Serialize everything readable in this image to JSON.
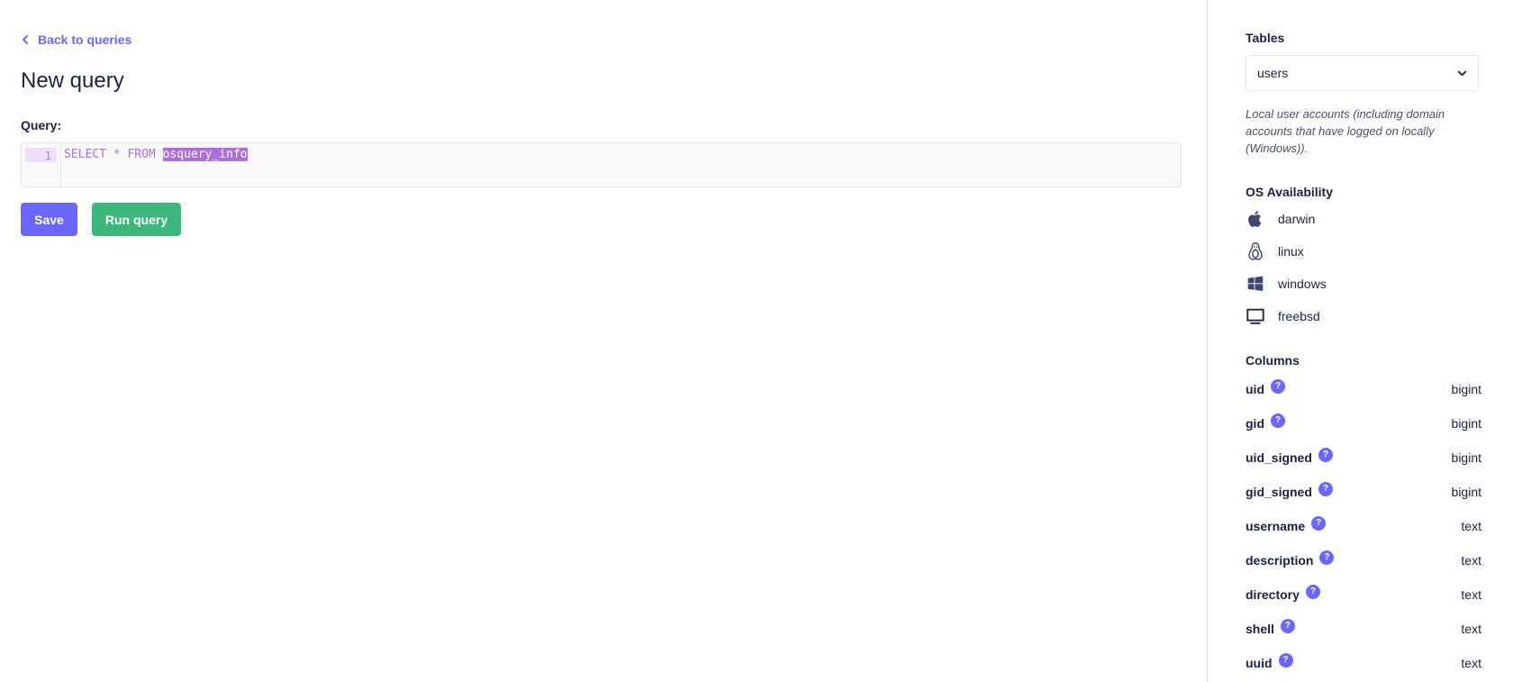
{
  "nav": {
    "back_label": "Back to queries"
  },
  "page": {
    "title": "New query",
    "query_label": "Query:"
  },
  "editor": {
    "line_number": "1",
    "keyword_select": "SELECT",
    "star": "*",
    "keyword_from": "FROM",
    "table_token": "osquery_info"
  },
  "actions": {
    "save_label": "Save",
    "run_label": "Run query"
  },
  "sidebar": {
    "tables_heading": "Tables",
    "selected_table": "users",
    "description": "Local user accounts (including domain accounts that have logged on locally (Windows)).",
    "os_heading": "OS Availability",
    "os": [
      {
        "label": "darwin",
        "icon": "apple-icon"
      },
      {
        "label": "linux",
        "icon": "linux-penguin-icon"
      },
      {
        "label": "windows",
        "icon": "windows-icon"
      },
      {
        "label": "freebsd",
        "icon": "monitor-icon"
      }
    ],
    "columns_heading": "Columns",
    "columns": [
      {
        "name": "uid",
        "type": "bigint"
      },
      {
        "name": "gid",
        "type": "bigint"
      },
      {
        "name": "uid_signed",
        "type": "bigint"
      },
      {
        "name": "gid_signed",
        "type": "bigint"
      },
      {
        "name": "username",
        "type": "text"
      },
      {
        "name": "description",
        "type": "text"
      },
      {
        "name": "directory",
        "type": "text"
      },
      {
        "name": "shell",
        "type": "text"
      },
      {
        "name": "uuid",
        "type": "text"
      }
    ]
  },
  "colors": {
    "accent": "#6a67fe",
    "run_button": "#3db67b",
    "text": "#192147",
    "code_keyword": "#ae6ddf"
  }
}
